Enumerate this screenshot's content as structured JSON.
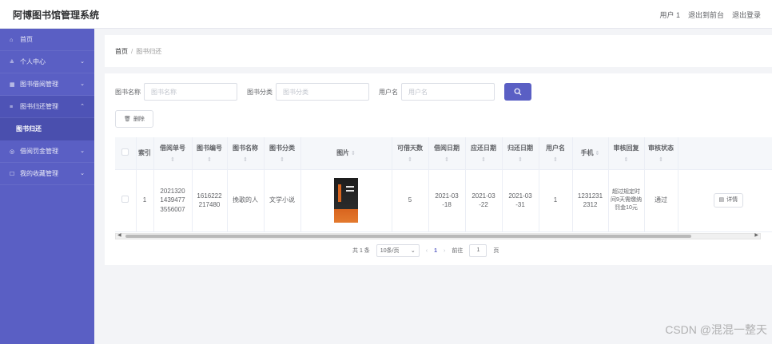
{
  "app": {
    "title": "阿博图书馆管理系统"
  },
  "top_links": {
    "user": "用户 1",
    "frontend": "退出到前台",
    "logout": "退出登录"
  },
  "sidebar": {
    "items": [
      {
        "label": "首页",
        "icon": "home-icon"
      },
      {
        "label": "个人中心",
        "icon": "user-icon"
      },
      {
        "label": "图书借阅管理",
        "icon": "book-icon"
      },
      {
        "label": "图书归还管理",
        "icon": "list-icon"
      },
      {
        "label": "图书归还"
      },
      {
        "label": "借阅罚金管理",
        "icon": "money-icon"
      },
      {
        "label": "我的收藏管理",
        "icon": "star-icon"
      }
    ]
  },
  "breadcrumb": {
    "home": "首页",
    "separator": "/",
    "current": "图书归还"
  },
  "filters": {
    "book_name_label": "图书名称",
    "book_name_placeholder": "图书名称",
    "category_label": "图书分类",
    "category_placeholder": "图书分类",
    "username_label": "用户名",
    "username_placeholder": "用户名"
  },
  "toolbar": {
    "delete_label": "删除"
  },
  "table": {
    "headers": {
      "index": "索引",
      "borrow_no": "借阅单号",
      "book_no": "图书编号",
      "book_name": "图书名称",
      "category": "图书分类",
      "image": "图片",
      "days": "可借天数",
      "borrow_date": "借阅日期",
      "due_date": "应还日期",
      "return_date": "归还日期",
      "username": "用户名",
      "phone": "手机",
      "review_reply": "审核回复",
      "review_status": "审核状态",
      "action": "操"
    },
    "rows": [
      {
        "index": "1",
        "borrow_no": "2021320 1439477 3556007",
        "book_no": "1616222 217480",
        "book_name": "挽歌的人",
        "category": "文学小说",
        "days": "5",
        "borrow_date": "2021-03 -18",
        "due_date": "2021-03 -22",
        "return_date": "2021-03 -31",
        "username": "1",
        "phone": "1231231 2312",
        "review_reply": "超过规定时间9天需缴纳罚金10元",
        "review_status": "通过",
        "action_label": "详情"
      }
    ]
  },
  "pagination": {
    "total": "共 1 条",
    "page_size": "10条/页",
    "current_page": "1",
    "goto_label": "前往",
    "goto_value": "1",
    "page_unit": "页"
  },
  "watermark": "CSDN @混混一整天",
  "colors": {
    "primary": "#5a5fc4",
    "sidebar_bg": "#5a5fc4"
  }
}
